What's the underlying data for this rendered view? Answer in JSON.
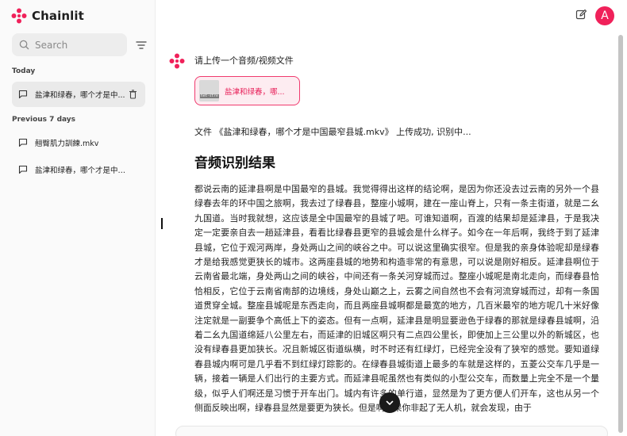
{
  "app": {
    "name": "Chainlit"
  },
  "sidebar": {
    "search_placeholder": "Search",
    "today_label": "Today",
    "today_threads": [
      {
        "label": "盐津和绿春，哪个才是中..."
      }
    ],
    "previous_label": "Previous 7 days",
    "previous_threads": [
      {
        "label": "翹臀肌力訓練.mkv"
      },
      {
        "label": "盐津和绿春，哪个才是中国..."
      }
    ]
  },
  "header": {
    "avatar_letter": "A"
  },
  "chat": {
    "prompt": "请上传一个音频/视频文件",
    "file_card": {
      "thumb_text": "het-stre",
      "name": "盐津和绿春，哪..."
    },
    "status": "文件 《盐津和绿春，哪个才是中国最窄县城.mkv》 上传成功, 识别中...",
    "heading": "音频识别结果",
    "transcript": "都说云南的延津县啊是中国最窄的县城。我觉得得出这样的结论啊，是因为你还没去过云南的另外一个县绿春去年的环中国之旅啊，我去过了绿春县，整座小城啊，建在一座山脊上，只有一条主街道，就是二幺九国道。当时我就想，这应该是全中国最窄的县城了吧。可谁知道啊，百渡的结果却是延津县，于是我决定一定要亲自去一趟延津县，看看比绿春县更窄的县城会是什么样子。如今在一年后啊，我终于到了延津县城，它位于观河两岸，身处两山之间的峡谷之中。可以说这里确实很窄。但是我的亲身体验呢却是绿春才是给我感觉更狭长的城市。这两座县城的地势和构造非常的有意思，可以说是刚好相反。延津县啊位于云南省最北端，身处两山之间的峡谷，中间还有一条关河穿城而过。整座小城呢是南北走向，而绿春县恰恰相反，它位于云南省南部的边境线，身处山巅之上，云雾之间自然也不会有河流穿城而过，却有一条国道贯穿全城。整座县城呢是东西走向，而且两座县城啊都是最宽的地方，几百米最窄的地方呢几十米好像注定就是一副要争个高低上下的姿态。但有一点啊，延津县是明显要逊色于绿春的那就是绿春县城啊，沿着二幺九国道绵延八公里左右，而延津的旧城区啊只有二点四公里长，即使加上三公里以外的新城区，也没有绿春县更加狭长。况且新城区街道纵横，时不时还有红绿灯，已经完全没有了狭窄的感觉。要知道绿春县城内啊可是几乎看不到红绿灯踪影的。在绿春县城街道上最多的车就是这样的，五菱公交车几乎是一辆，接着一辆是人们出行的主要方式。而延津县呢虽然也有类似的小型公交车，而数量上完全不是一个量级，似乎人们啊还是习惯于开车出门。城内有许多的单行道，显然是为了更方便人们开车，这也从另一个侧面反映出啊，绿春县显然是要更为狭长。但是啊如果你非起了无人机，就会发现，由于"
  },
  "colors": {
    "accent": "#f0215a",
    "file_card_bg": "#fdecf1",
    "active_thread_bg": "#eaeaea"
  },
  "icons": [
    "chainlit-logo-icon",
    "search-icon",
    "filter-icon",
    "chat-bubble-icon",
    "trash-icon",
    "edit-icon",
    "chevron-down-icon"
  ]
}
